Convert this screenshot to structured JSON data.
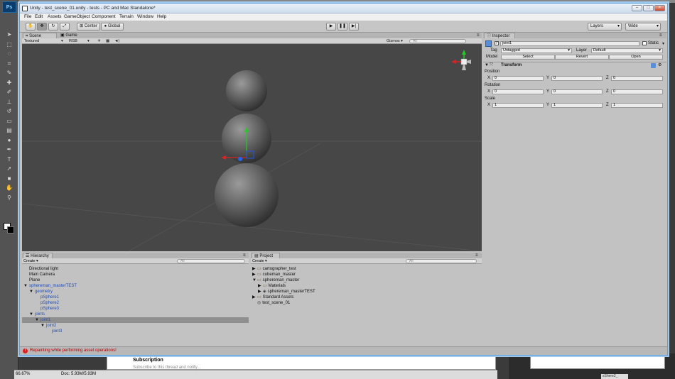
{
  "photoshop": {
    "logo": "Ps",
    "zoom": "66.67%",
    "doc": "Doc: 5.93M/5.93M",
    "tools": [
      "move-icon",
      "marquee-icon",
      "lasso-icon",
      "crop-icon",
      "eyedropper-icon",
      "healing-icon",
      "brush-icon",
      "stamp-icon",
      "history-brush-icon",
      "eraser-icon",
      "gradient-icon",
      "dodge-icon",
      "pen-icon",
      "type-icon",
      "path-select-icon",
      "shape-icon",
      "hand-icon",
      "zoom-icon"
    ]
  },
  "browser": {
    "subscription_title": "Subscription",
    "subscription_text": "Subscribe to this thread and notify..."
  },
  "taskbar": {
    "right_tab": "sShere2_"
  },
  "window": {
    "title": "Unity - test_scene_01.unity - tests - PC and Mac Standalone*",
    "menus": [
      "File",
      "Edit",
      "Assets",
      "GameObject",
      "Component",
      "Terrain",
      "Window",
      "Help"
    ]
  },
  "toolbar": {
    "center_label": "Center",
    "global_label": "Global",
    "layers_label": "Layers",
    "layout_label": "Wide"
  },
  "scene": {
    "tabs": [
      "Scene",
      "Game"
    ],
    "render_mode": "Textured",
    "color_mode": "RGB",
    "gizmos_label": "Gizmos",
    "search_placeholder": "All"
  },
  "hierarchy": {
    "tab": "Hierarchy",
    "create": "Create",
    "search_placeholder": "All",
    "items": [
      {
        "label": "Directional light",
        "indent": 0,
        "blue": false,
        "arrow": ""
      },
      {
        "label": "Main Camera",
        "indent": 0,
        "blue": false,
        "arrow": ""
      },
      {
        "label": "Plane",
        "indent": 0,
        "blue": false,
        "arrow": ""
      },
      {
        "label": "sphereman_masterTEST",
        "indent": 0,
        "blue": true,
        "arrow": "▼"
      },
      {
        "label": "geometry",
        "indent": 1,
        "blue": true,
        "arrow": "▼"
      },
      {
        "label": "pSphere1",
        "indent": 2,
        "blue": true,
        "arrow": ""
      },
      {
        "label": "pSphere2",
        "indent": 2,
        "blue": true,
        "arrow": ""
      },
      {
        "label": "pSphere3",
        "indent": 2,
        "blue": true,
        "arrow": ""
      },
      {
        "label": "joints",
        "indent": 1,
        "blue": true,
        "arrow": "▼"
      },
      {
        "label": "joint1",
        "indent": 2,
        "blue": true,
        "arrow": "▼",
        "selected": true
      },
      {
        "label": "joint2",
        "indent": 3,
        "blue": true,
        "arrow": "▼"
      },
      {
        "label": "joint3",
        "indent": 4,
        "blue": true,
        "arrow": ""
      }
    ]
  },
  "project": {
    "tab": "Project",
    "create": "Create",
    "search_placeholder": "All",
    "items": [
      {
        "label": "cartographer_test",
        "indent": 0,
        "arrow": "▶",
        "icon": "folder"
      },
      {
        "label": "cubeman_master",
        "indent": 0,
        "arrow": "▶",
        "icon": "folder"
      },
      {
        "label": "sphereman_master",
        "indent": 0,
        "arrow": "▼",
        "icon": "folder"
      },
      {
        "label": "Materials",
        "indent": 1,
        "arrow": "▶",
        "icon": "folder"
      },
      {
        "label": "sphereman_masterTEST",
        "indent": 1,
        "arrow": "▶",
        "icon": "prefab"
      },
      {
        "label": "Standard Assets",
        "indent": 0,
        "arrow": "▶",
        "icon": "folder"
      },
      {
        "label": "test_scene_01",
        "indent": 0,
        "arrow": "",
        "icon": "scene"
      }
    ]
  },
  "inspector": {
    "tab": "Inspector",
    "object_name": "joint1",
    "static_label": "Static",
    "tag_label": "Tag",
    "tag_value": "Untagged",
    "layer_label": "Layer",
    "layer_value": "Default",
    "model_label": "Model",
    "select_label": "Select",
    "revert_label": "Revert",
    "open_label": "Open",
    "transform_title": "Transform",
    "position_label": "Position",
    "rotation_label": "Rotation",
    "scale_label": "Scale",
    "axis_x": "X",
    "axis_y": "Y",
    "axis_z": "Z",
    "position": {
      "x": "0",
      "y": "0",
      "z": "0"
    },
    "rotation": {
      "x": "0",
      "y": "0",
      "z": "0"
    },
    "scale": {
      "x": "1",
      "y": "1",
      "z": "1"
    }
  },
  "status": {
    "message": "Repainting while performing asset operations!"
  }
}
